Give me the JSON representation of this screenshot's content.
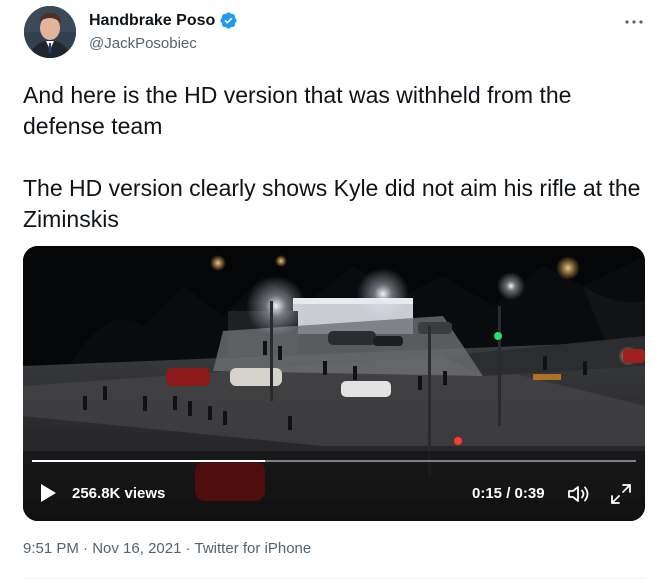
{
  "author": {
    "name": "Handbrake Poso",
    "handle": "@JackPosobiec",
    "verified": true,
    "avatar_icon": "avatar-portrait",
    "verified_icon": "verified-badge-icon",
    "verified_color": "#1d9bf0"
  },
  "menu": {
    "icon": "more-horizontal-icon"
  },
  "tweet": {
    "text": "And here is the HD version that was withheld from the defense team\n\nThe HD version clearly shows Kyle did not aim his rifle at the Ziminskis"
  },
  "video": {
    "views": "256.8K views",
    "time": "0:15 / 0:39",
    "progress": 0.385,
    "play_icon": "play-icon",
    "volume_icon": "volume-icon",
    "fullscreen_icon": "fullscreen-icon"
  },
  "meta": {
    "time": "9:51 PM",
    "separator1": " · ",
    "date": "Nov 16, 2021",
    "separator2": " · ",
    "source": "Twitter for iPhone"
  },
  "colors": {
    "text_primary": "#0f1419",
    "text_secondary": "#536471",
    "accent": "#1d9bf0"
  }
}
